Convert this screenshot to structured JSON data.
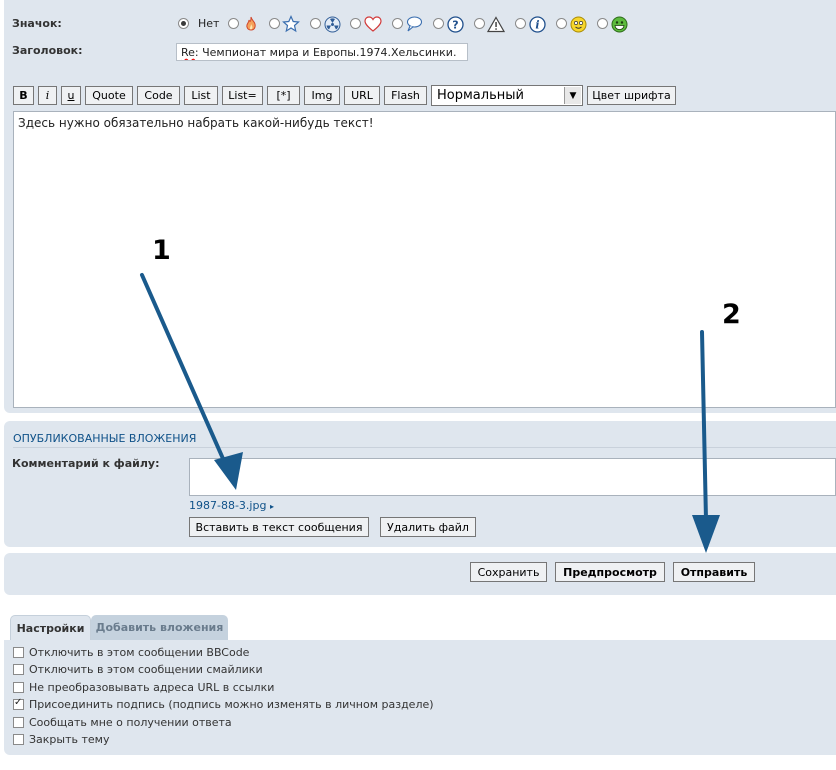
{
  "form": {
    "icon_label": "Значок:",
    "icon_none": "Нет",
    "subject_label": "Заголовок:",
    "subject_prefix": "Re",
    "subject_rest": ": Чемпионат мира и Европы.1974.Хельсинки."
  },
  "icons": [
    "fire-icon",
    "star-icon",
    "radioactive-icon",
    "heart-icon",
    "speech-bubble-icon",
    "question-icon",
    "warning-icon",
    "info-icon",
    "lightbulb-smiley-icon",
    "grin-smiley-icon"
  ],
  "toolbar": {
    "bold": "B",
    "italic": "i",
    "underline": "u",
    "quote": "Quote",
    "code": "Code",
    "list": "List",
    "list_eq": "List=",
    "list_item": "[*]",
    "img": "Img",
    "url": "URL",
    "flash": "Flash",
    "font_size": "Нормальный",
    "font_color": "Цвет шрифта"
  },
  "editor": {
    "text": "Здесь нужно обязательно набрать какой-нибудь текст!"
  },
  "attachments": {
    "title": "ОПУБЛИКОВАННЫЕ ВЛОЖЕНИЯ",
    "comment_label": "Комментарий к файлу:",
    "file_name": "1987-88-3.jpg",
    "insert_button": "Вставить в текст сообщения",
    "delete_button": "Удалить файл"
  },
  "submit": {
    "save": "Сохранить",
    "preview": "Предпросмотр",
    "send": "Отправить"
  },
  "tabs": {
    "settings": "Настройки",
    "add_attachments": "Добавить вложения"
  },
  "options": [
    {
      "label": "Отключить в этом сообщении BBCode",
      "checked": false
    },
    {
      "label": "Отключить в этом сообщении смайлики",
      "checked": false
    },
    {
      "label": "Не преобразовывать адреса URL в ссылки",
      "checked": false
    },
    {
      "label": "Присоединить подпись (подпись можно изменять в личном разделе)",
      "checked": true
    },
    {
      "label": "Сообщать мне о получении ответа",
      "checked": false
    },
    {
      "label": "Закрыть тему",
      "checked": false
    }
  ],
  "annotations": {
    "marker_1": "1",
    "marker_2": "2",
    "arrow_color": "#1a5a8c"
  }
}
